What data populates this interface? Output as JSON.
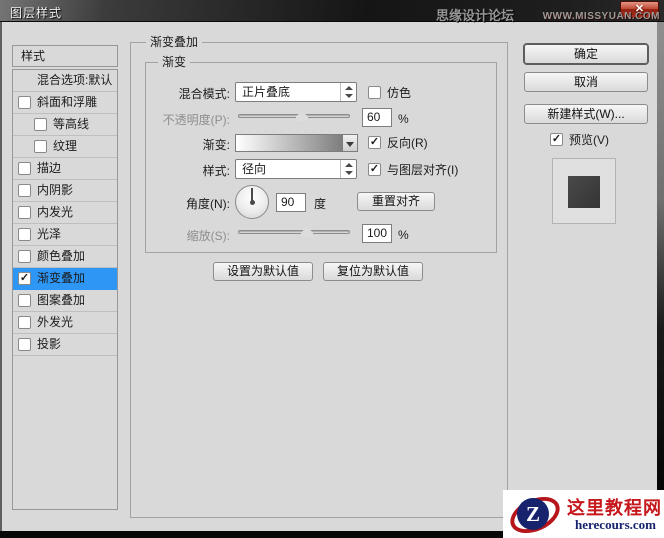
{
  "window": {
    "title": "图层样式",
    "watermark_site": "思缘设计论坛",
    "watermark_url": "WWW.MISSYUAN.COM",
    "close_glyph": "✕"
  },
  "sidebar": {
    "header": "样式",
    "items": [
      {
        "label": "混合选项:默认",
        "checkbox": false,
        "checked": false,
        "indent": false,
        "selected": false
      },
      {
        "label": "斜面和浮雕",
        "checkbox": true,
        "checked": false,
        "indent": false,
        "selected": false
      },
      {
        "label": "等高线",
        "checkbox": true,
        "checked": false,
        "indent": true,
        "selected": false
      },
      {
        "label": "纹理",
        "checkbox": true,
        "checked": false,
        "indent": true,
        "selected": false
      },
      {
        "label": "描边",
        "checkbox": true,
        "checked": false,
        "indent": false,
        "selected": false
      },
      {
        "label": "内阴影",
        "checkbox": true,
        "checked": false,
        "indent": false,
        "selected": false
      },
      {
        "label": "内发光",
        "checkbox": true,
        "checked": false,
        "indent": false,
        "selected": false
      },
      {
        "label": "光泽",
        "checkbox": true,
        "checked": false,
        "indent": false,
        "selected": false
      },
      {
        "label": "颜色叠加",
        "checkbox": true,
        "checked": false,
        "indent": false,
        "selected": false
      },
      {
        "label": "渐变叠加",
        "checkbox": true,
        "checked": true,
        "indent": false,
        "selected": true
      },
      {
        "label": "图案叠加",
        "checkbox": true,
        "checked": false,
        "indent": false,
        "selected": false
      },
      {
        "label": "外发光",
        "checkbox": true,
        "checked": false,
        "indent": false,
        "selected": false
      },
      {
        "label": "投影",
        "checkbox": true,
        "checked": false,
        "indent": false,
        "selected": false
      }
    ]
  },
  "panel": {
    "group_title": "渐变叠加",
    "subgroup_title": "渐变",
    "blend_mode": {
      "label": "混合模式:",
      "value": "正片叠底",
      "dither_label": "仿色",
      "dither_checked": false
    },
    "opacity": {
      "label": "不透明度(P):",
      "value": "60",
      "unit": "%",
      "percent": 60
    },
    "gradient": {
      "label": "渐变:",
      "reverse_label": "反向(R)",
      "reverse_checked": true
    },
    "style": {
      "label": "样式:",
      "value": "径向",
      "align_label": "与图层对齐(I)",
      "align_checked": true
    },
    "angle": {
      "label": "角度(N):",
      "value": "90",
      "unit": "度",
      "reset_button": "重置对齐"
    },
    "scale": {
      "label": "缩放(S):",
      "value": "100",
      "unit": "%",
      "percent": 100
    },
    "make_default_button": "设置为默认值",
    "reset_default_button": "复位为默认值"
  },
  "actions": {
    "ok": "确定",
    "cancel": "取消",
    "new_style": "新建样式(W)...",
    "preview_label": "预览(V)",
    "preview_checked": true
  },
  "logo": {
    "letter": "Z",
    "title": "这里教程网",
    "url": "herecours.com"
  },
  "colors": {
    "selection_blue": "#2e96f5",
    "dialog_bg": "#d9d9d9",
    "titlebar_dark": "#1a1a1a",
    "close_red": "#a5301d",
    "logo_red": "#c5171c",
    "logo_navy": "#17246d"
  }
}
